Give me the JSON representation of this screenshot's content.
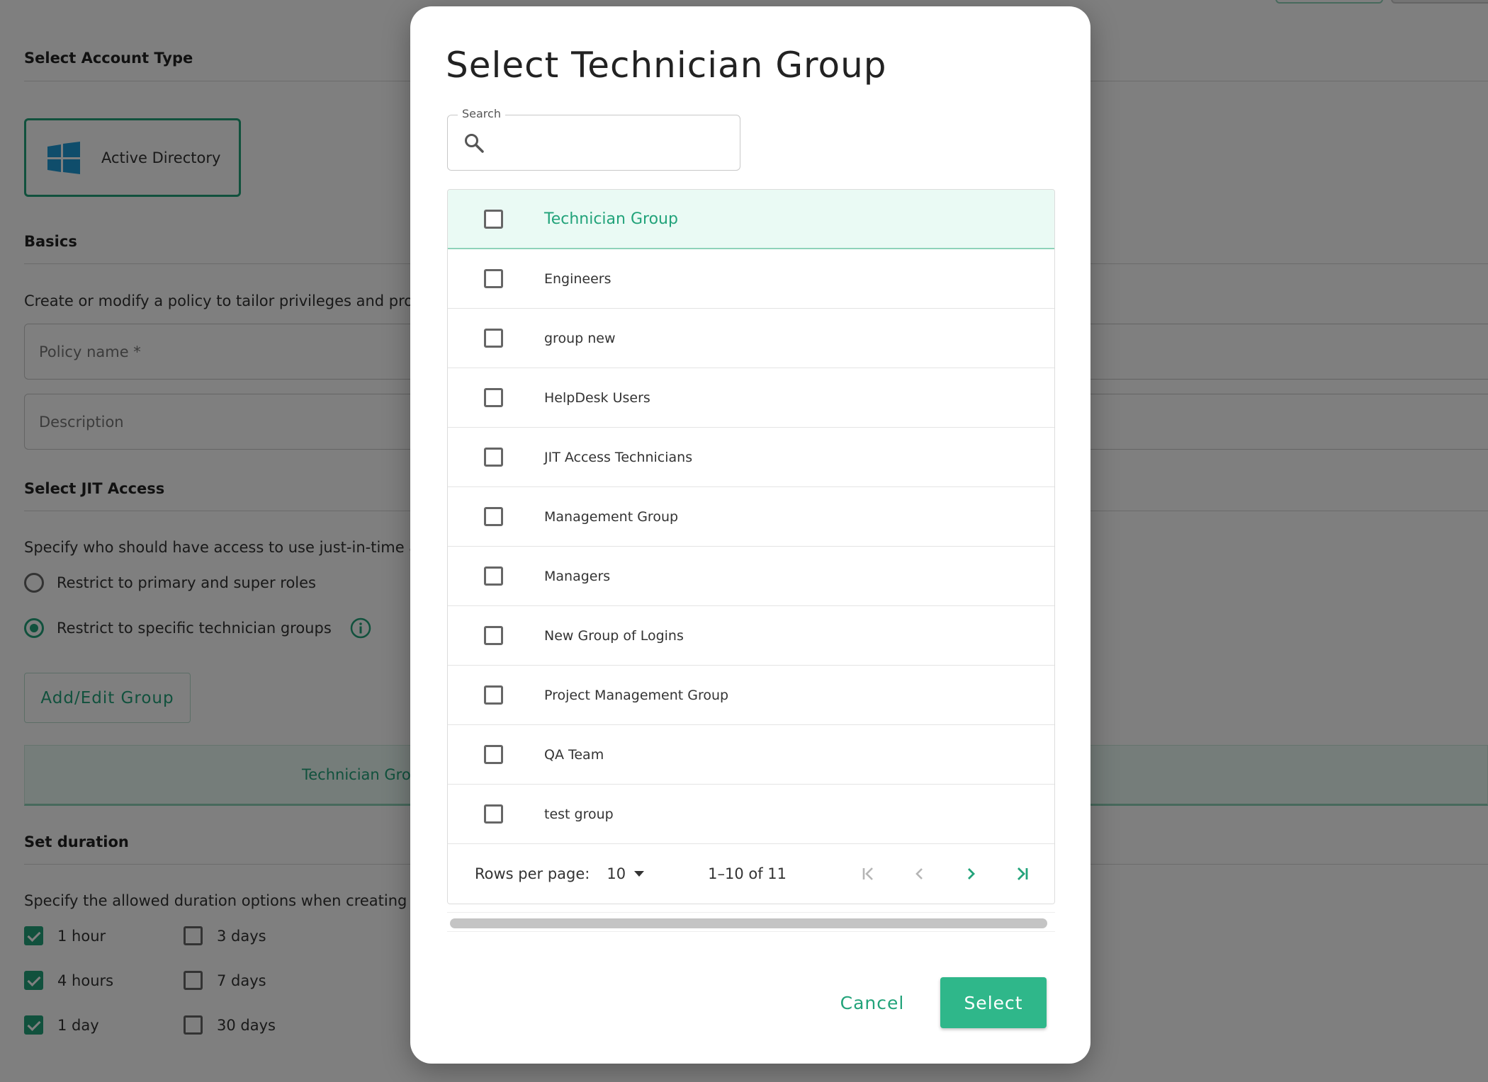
{
  "background": {
    "account_type": {
      "title": "Select Account Type",
      "option_label": "Active Directory"
    },
    "basics": {
      "title": "Basics",
      "description": "Create or modify a policy to tailor privileges and provid",
      "policy_name_placeholder": "Policy name *",
      "description_placeholder": "Description"
    },
    "jit_access": {
      "title": "Select JIT Access",
      "description": "Specify who should have access to use just-in-time acce",
      "radio_primary": "Restrict to primary and super roles",
      "radio_specific": "Restrict to specific technician groups",
      "add_edit_label": "Add/Edit Group",
      "table_header": "Technician Gro"
    },
    "duration": {
      "title": "Set duration",
      "description": "Specify the allowed duration options when creating or",
      "options": [
        {
          "label": "1 hour",
          "checked": true
        },
        {
          "label": "3 days",
          "checked": false
        },
        {
          "label": "4 hours",
          "checked": true
        },
        {
          "label": "7 days",
          "checked": false
        },
        {
          "label": "1 day",
          "checked": true
        },
        {
          "label": "30 days",
          "checked": false
        }
      ]
    }
  },
  "modal": {
    "title": "Select Technician Group",
    "search": {
      "label": "Search",
      "value": "",
      "placeholder": ""
    },
    "table": {
      "header": "Technician Group",
      "rows": [
        "Engineers",
        "group new",
        "HelpDesk Users",
        "JIT Access Technicians",
        "Management Group",
        "Managers",
        "New Group of Logins",
        "Project Management Group",
        "QA Team",
        "test group"
      ]
    },
    "pagination": {
      "rows_per_page_label": "Rows per page:",
      "rows_per_page_value": "10",
      "range": "1–10 of 11"
    },
    "cancel_label": "Cancel",
    "select_label": "Select"
  },
  "colors": {
    "accent": "#22a37a",
    "primary_button": "#2fb78a",
    "header_bg": "#eafaf4",
    "windows_logo": "#1e9ad6"
  }
}
